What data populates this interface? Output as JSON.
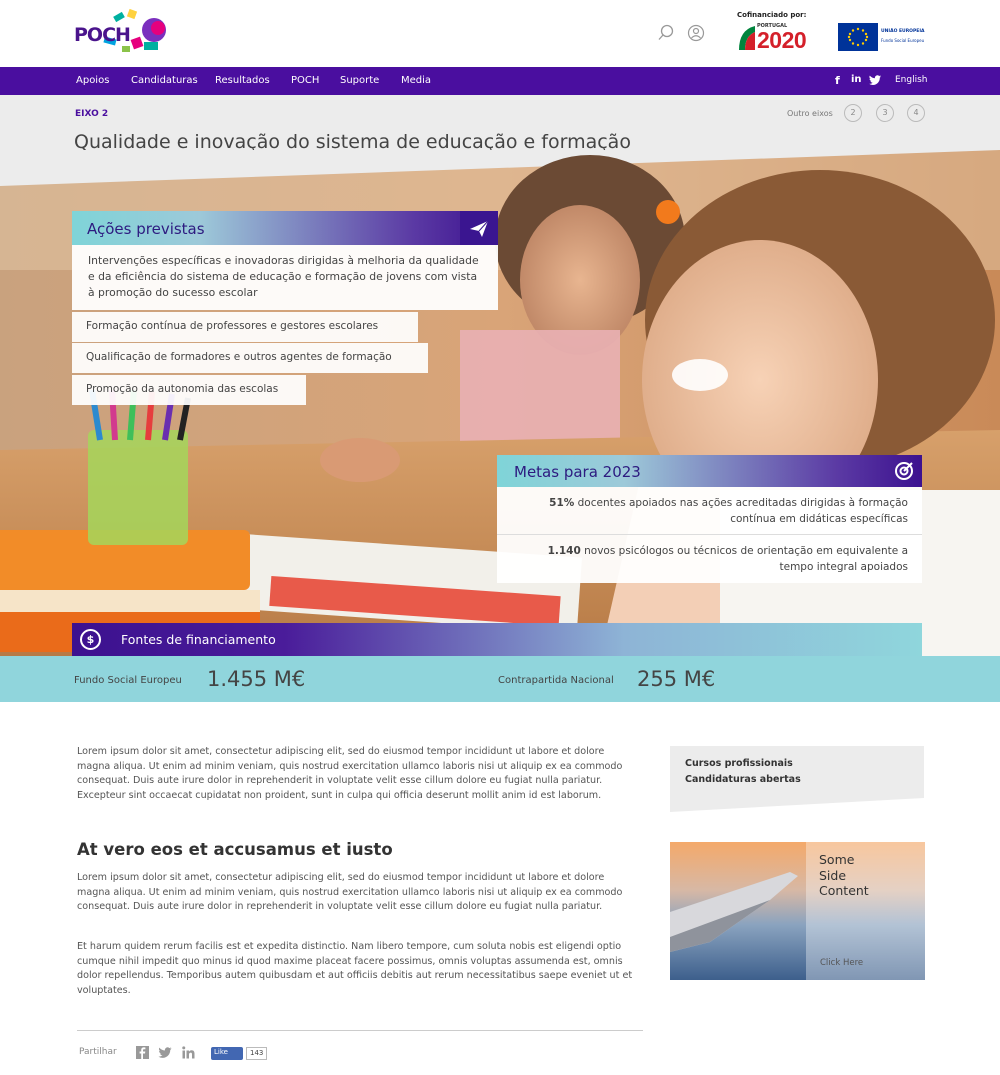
{
  "header": {
    "logo_text": "POCH",
    "cofinanciado": "Cofinanciado por:",
    "portugal_label": "PORTUGAL",
    "portugal_year": "2020",
    "eu_line1": "UNIÃO EUROPEIA",
    "eu_line2": "Fundo Social Europeu"
  },
  "nav": {
    "items": [
      "Apoios",
      "Candidaturas",
      "Resultados",
      "POCH",
      "Suporte",
      "Media"
    ],
    "social": [
      "f",
      "in",
      "twitter"
    ],
    "language": "English"
  },
  "title_band": {
    "eixo_label": "EIXO 2",
    "title": "Qualidade e inovação do sistema de educação e formação",
    "outros_label": "Outro eixos",
    "other_axes": [
      "2",
      "3",
      "4"
    ]
  },
  "acoes": {
    "title": "Ações previstas",
    "description": "Intervenções específicas e inovadoras dirigidas à melhoria da qualidade e da eficiência do sistema de educação e formação de jovens com vista à promoção do sucesso escolar",
    "items": [
      "Formação contínua de professores e gestores escolares",
      "Qualificação de formadores e outros agentes de formação",
      "Promoção da autonomia das escolas"
    ]
  },
  "metas": {
    "title": "Metas para 2023",
    "items": [
      {
        "value": "51%",
        "text": " docentes apoiados nas ações acreditadas dirigidas à formação contínua em didáticas específicas"
      },
      {
        "value": "1.140",
        "text": " novos psicólogos ou técnicos de orientação em equivalente a tempo integral apoiados"
      }
    ]
  },
  "funding": {
    "title": "Fontes de financiamento",
    "icon": "$",
    "fse_label": "Fundo Social Europeu",
    "fse_value": "1.455 M€",
    "nacional_label": "Contrapartida Nacional",
    "nacional_value": "255 M€"
  },
  "content": {
    "para1": "Lorem ipsum dolor sit amet, consectetur adipiscing elit, sed do eiusmod tempor incididunt ut labore et dolore magna aliqua. Ut enim ad minim veniam, quis nostrud exercitation ullamco laboris nisi ut aliquip ex ea commodo consequat. Duis aute irure dolor in reprehenderit in voluptate velit esse cillum dolore eu fugiat nulla pariatur. Excepteur sint occaecat cupidatat non proident, sunt in culpa qui officia deserunt mollit anim id est laborum.",
    "subheading": "At vero eos et accusamus et iusto",
    "para2": "Lorem ipsum dolor sit amet, consectetur adipiscing elit, sed do eiusmod tempor incididunt ut labore et dolore magna aliqua. Ut enim ad minim veniam, quis nostrud exercitation ullamco laboris nisi ut aliquip ex ea commodo consequat. Duis aute irure dolor in reprehenderit in voluptate velit esse cillum dolore eu fugiat nulla pariatur.",
    "para3": "Et harum quidem rerum facilis est et expedita distinctio. Nam libero tempore, cum soluta nobis est eligendi optio cumque nihil impedit quo minus id quod maxime placeat facere possimus, omnis voluptas assumenda est, omnis dolor repellendus. Temporibus autem quibusdam et aut officiis debitis aut rerum necessitatibus saepe eveniet ut et voluptates."
  },
  "sidebar": {
    "link1": "Cursos profissionais",
    "link2": "Candidaturas abertas",
    "promo_line1": "Some",
    "promo_line2": "Side",
    "promo_line3": "Content",
    "promo_cta": "Click Here"
  },
  "share": {
    "label": "Partilhar",
    "like_label": "Like",
    "like_count": "143"
  },
  "colors": {
    "purple": "#4a0e9f",
    "teal": "#90d5dc",
    "gray_band": "#ececec"
  }
}
